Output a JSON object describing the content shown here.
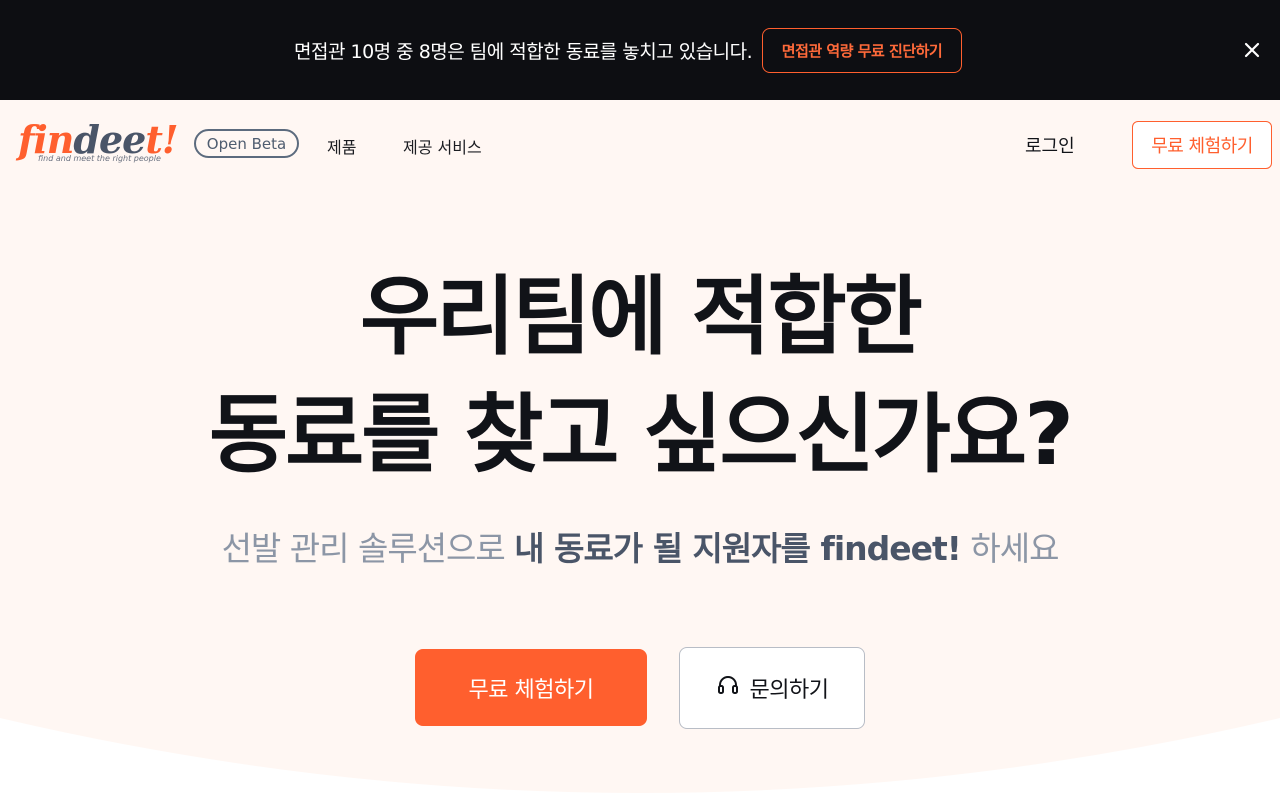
{
  "announcement": {
    "text": "면접관 10명 중 8명은 팀에 적합한 동료를 놓치고 있습니다.",
    "cta_label": "면접관 역량 무료 진단하기",
    "close_icon": "close-icon"
  },
  "header": {
    "logo_parts": [
      "fin",
      "dee",
      "t!"
    ],
    "logo_tagline": "find and meet the right people",
    "badge": "Open Beta",
    "nav": [
      "제품",
      "제공 서비스"
    ],
    "login_label": "로그인",
    "cta_label": "무료 체험하기"
  },
  "hero": {
    "title_line1": "우리팀에 적합한",
    "title_line2": "동료를 찾고 싶으신가요?",
    "subtitle_pre": "선발 관리 솔루션으로 ",
    "subtitle_strong": "내 동료가 될 지원자를 findeet!",
    "subtitle_post": " 하세요",
    "primary_button": "무료 체험하기",
    "secondary_button": "문의하기",
    "secondary_icon": "headset-icon"
  },
  "colors": {
    "accent": "#ff5f2e",
    "topbar_bg": "#0d0e12",
    "page_bg": "#fff7f3"
  }
}
